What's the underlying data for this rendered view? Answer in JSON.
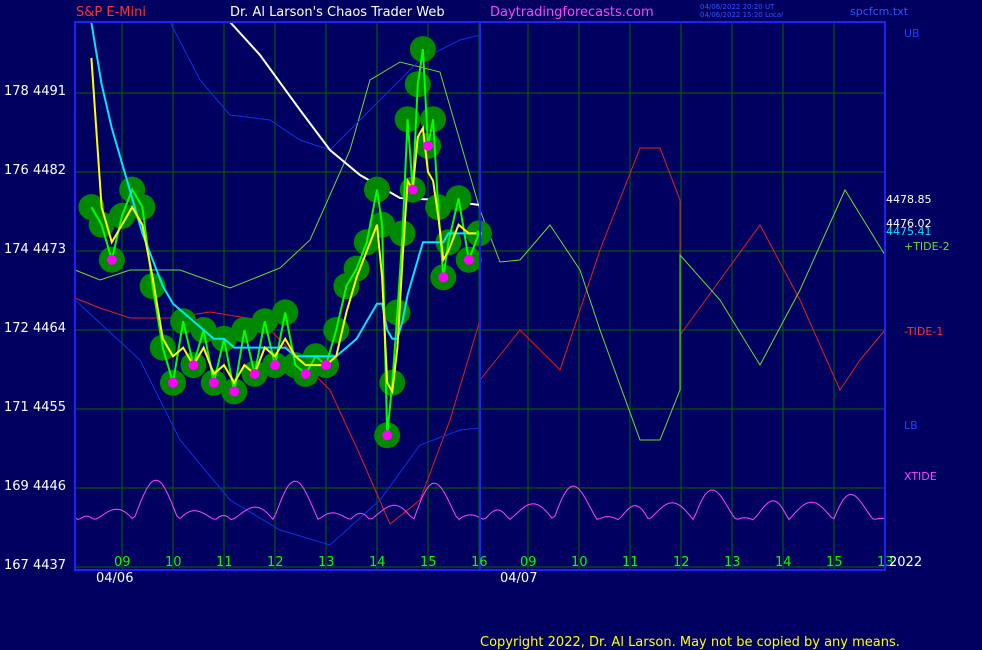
{
  "header": {
    "symbol": "S&P E-Mini",
    "author": "Dr. Al Larson's Chaos Trader Web",
    "site": "Daytradingforecasts.com",
    "timestamp_utc": "04/06/2022 20:20 UT",
    "timestamp_local": "04/06/2022 15:20 Local",
    "file": "spcfcm.txt"
  },
  "footer": {
    "copyright": "Copyright 2022, Dr. Al Larson. May not be copied by any means."
  },
  "colors": {
    "background": "#000060",
    "frame": "#2020ff",
    "grid": "#006800",
    "price": "#00ff00",
    "price_glow": "#008800",
    "yellow_avg": "#ffff00",
    "cyan_avg": "#00e5ff",
    "white_avg": "#ffffff",
    "tide2": "#66dd33",
    "tide1": "#dd2222",
    "xtide": "#ff44ff",
    "bands": "#1030e0",
    "magenta_dots": "#ff00ff"
  },
  "chart_data": {
    "type": "line",
    "title": "S&P E-Mini",
    "y_left_labels": [
      {
        "spx": "178",
        "es": "4491"
      },
      {
        "spx": "176",
        "es": "4482"
      },
      {
        "spx": "174",
        "es": "4473"
      },
      {
        "spx": "172",
        "es": "4464"
      },
      {
        "spx": "171",
        "es": "4455"
      },
      {
        "spx": "169",
        "es": "4446"
      },
      {
        "spx": "167",
        "es": "4437"
      }
    ],
    "ylim": [
      4437,
      4500
    ],
    "x_hour_labels": [
      "09",
      "10",
      "11",
      "12",
      "13",
      "14",
      "15",
      "16",
      "09",
      "10",
      "11",
      "12",
      "13",
      "14",
      "15",
      "13"
    ],
    "x_dates": [
      "04/06",
      "04/07"
    ],
    "year_label": "2022",
    "right_values": [
      {
        "label": "4478.85",
        "color": "#ffffff"
      },
      {
        "label": "4476.02",
        "color": "#ffffff"
      },
      {
        "label": "4475.41",
        "color": "#00e5ff"
      }
    ],
    "series_labels": [
      {
        "name": "UB",
        "color": "#2040ff"
      },
      {
        "name": "+TIDE-2",
        "color": "#66dd33"
      },
      {
        "name": "-TIDE-1",
        "color": "#ff3333"
      },
      {
        "name": "LB",
        "color": "#2040ff"
      },
      {
        "name": "XTIDE",
        "color": "#ff44ff"
      }
    ],
    "x_hours": [
      8.4,
      8.6,
      8.8,
      9.0,
      9.2,
      9.4,
      9.6,
      9.8,
      10.0,
      10.2,
      10.4,
      10.6,
      10.8,
      11.0,
      11.2,
      11.4,
      11.6,
      11.8,
      12.0,
      12.2,
      12.4,
      12.6,
      12.8,
      13.0,
      13.2,
      13.4,
      13.6,
      13.8,
      14.0,
      14.1,
      14.2,
      14.3,
      14.4,
      14.5,
      14.6,
      14.7,
      14.8,
      14.9,
      15.0,
      15.1,
      15.2,
      15.3,
      15.4,
      15.6,
      15.8,
      16.0
    ],
    "series": [
      {
        "name": "price",
        "values": [
          4478,
          4476,
          4472,
          4477,
          4480,
          4478,
          4469,
          4462,
          4458,
          4465,
          4460,
          4464,
          4458,
          4463,
          4457,
          4464,
          4459,
          4465,
          4460,
          4466,
          4460,
          4459,
          4461,
          4460,
          4464,
          4469,
          4471,
          4474,
          4480,
          4476,
          4452,
          4458,
          4466,
          4475,
          4488,
          4480,
          4492,
          4496,
          4485,
          4488,
          4478,
          4470,
          4474,
          4479,
          4472,
          4475
        ]
      },
      {
        "name": "yellow-average",
        "values": [
          4495,
          4478,
          4474,
          4476,
          4478,
          4476,
          4470,
          4463,
          4461,
          4462,
          4460,
          4462,
          4459,
          4460,
          4458,
          4460,
          4459,
          4462,
          4461,
          4463,
          4461,
          4460,
          4460,
          4460,
          4461,
          4466,
          4470,
          4473,
          4476,
          4470,
          4458,
          4457,
          4462,
          4472,
          4481,
          4480,
          4486,
          4487,
          4482,
          4481,
          4477,
          4472,
          4473,
          4476,
          4475,
          4475
        ]
      },
      {
        "name": "cyan-average",
        "values": [
          4499,
          4492,
          4487,
          4483,
          4479,
          4475,
          4472,
          4469,
          4467,
          4466,
          4465,
          4464,
          4463,
          4463,
          4462,
          4462,
          4462,
          4462,
          4462,
          4462,
          4461,
          4461,
          4461,
          4461,
          4461,
          4462,
          4463,
          4465,
          4467,
          4467,
          4464,
          4463,
          4463,
          4465,
          4468,
          4470,
          4472,
          4474,
          4474,
          4474,
          4474,
          4474,
          4475,
          4475,
          4475,
          4475
        ]
      }
    ]
  }
}
